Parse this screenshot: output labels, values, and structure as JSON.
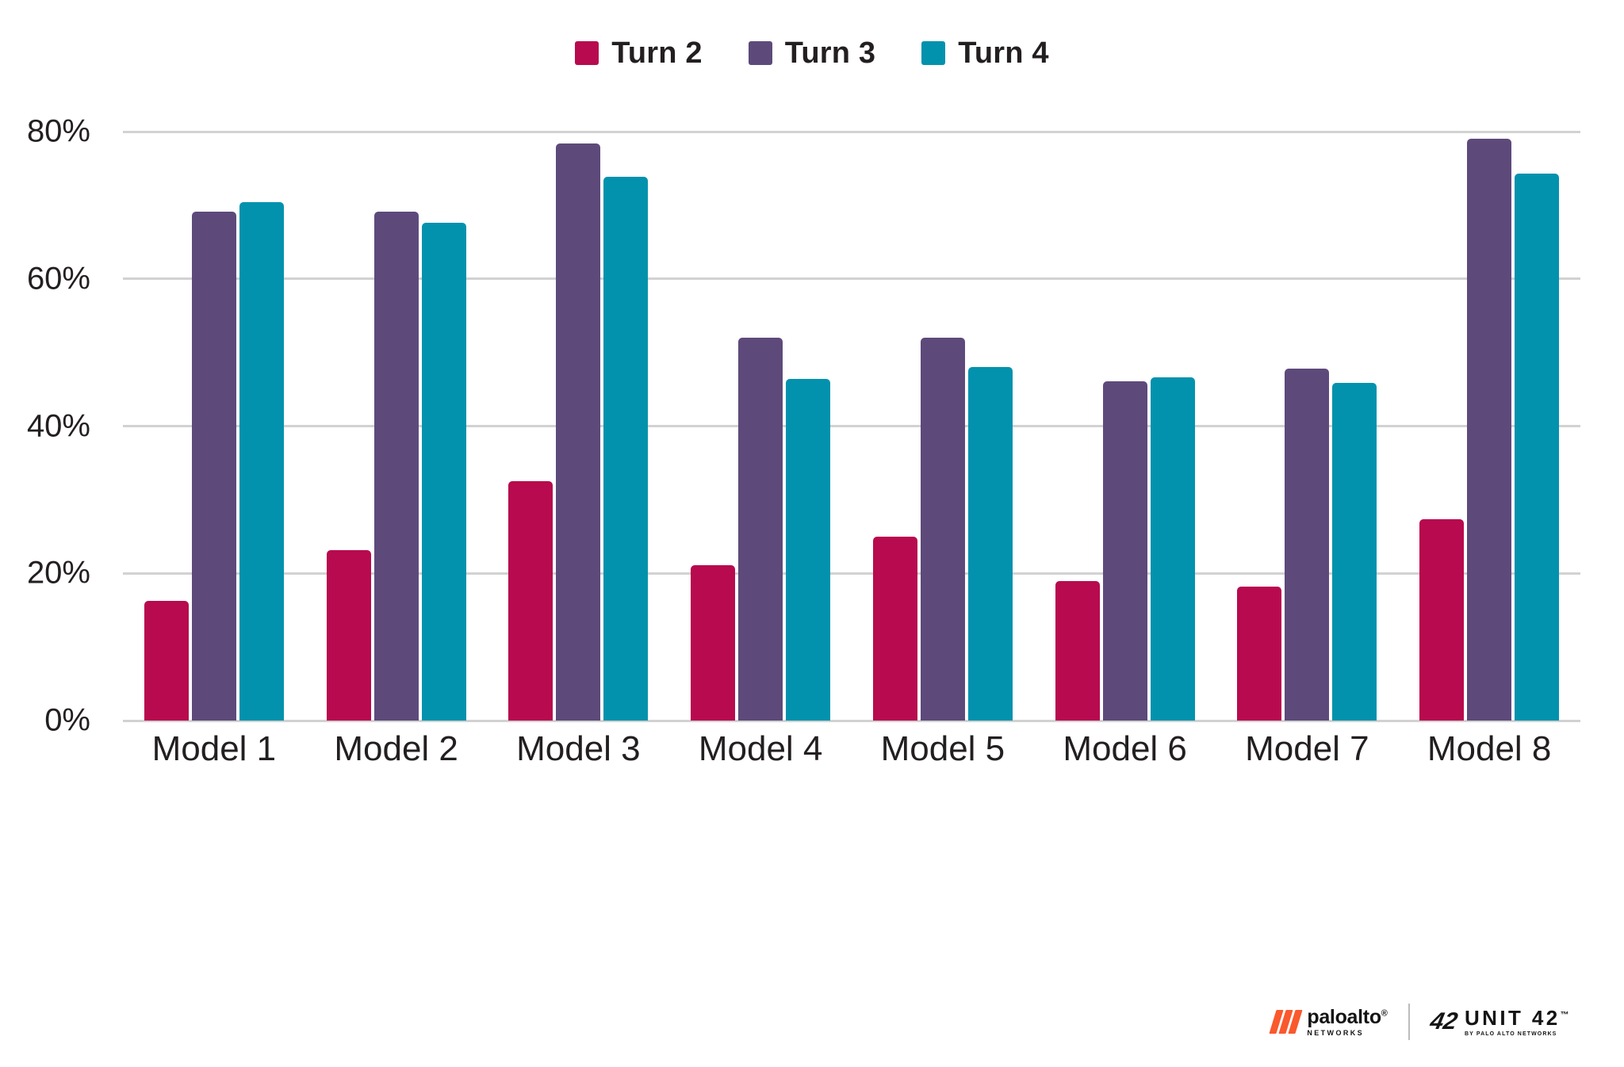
{
  "colors": {
    "turn2": "#b80a4e",
    "turn3": "#5d4a7b",
    "turn4": "#0292ad",
    "gridline": "#d2d2d2",
    "text": "#231f20",
    "brand_orange": "#fa582d"
  },
  "legend": {
    "position": "top-center",
    "items": [
      {
        "label": "Turn 2",
        "color": "#b80a4e",
        "swatch_name": "legend-swatch-turn-2"
      },
      {
        "label": "Turn 3",
        "color": "#5d4a7b",
        "swatch_name": "legend-swatch-turn-3"
      },
      {
        "label": "Turn 4",
        "color": "#0292ad",
        "swatch_name": "legend-swatch-turn-4"
      }
    ]
  },
  "footer": {
    "paloalto_name": "paloalto",
    "paloalto_sub": "NETWORKS",
    "paloalto_tm": "®",
    "unit42_slash": "42",
    "unit42_name": "UNIT 42",
    "unit42_sub": "BY PALO ALTO NETWORKS",
    "unit42_tm": "™"
  },
  "chart_data": {
    "type": "bar",
    "title": "",
    "subtitle": "",
    "xlabel": "",
    "ylabel": "",
    "ylim": [
      0,
      80
    ],
    "grid": true,
    "legend_position": "top-center",
    "ytick_labels": [
      "80%",
      "60%",
      "40%",
      "20%",
      "0%"
    ],
    "ytick_values": [
      80,
      60,
      40,
      20,
      0
    ],
    "categories": [
      "Model 1",
      "Model 2",
      "Model 3",
      "Model 4",
      "Model 5",
      "Model 6",
      "Model 7",
      "Model 8"
    ],
    "series": [
      {
        "name": "Turn 2",
        "color": "#b80a4e",
        "values": [
          16.3,
          23.1,
          32.5,
          21.1,
          25.0,
          19.0,
          18.2,
          27.4
        ]
      },
      {
        "name": "Turn 3",
        "color": "#5d4a7b",
        "values": [
          69.1,
          69.1,
          78.4,
          52.0,
          52.0,
          46.1,
          47.8,
          79.0
        ]
      },
      {
        "name": "Turn 4",
        "color": "#0292ad",
        "values": [
          70.4,
          67.6,
          73.9,
          46.4,
          48.0,
          46.6,
          45.9,
          74.3
        ]
      }
    ]
  }
}
